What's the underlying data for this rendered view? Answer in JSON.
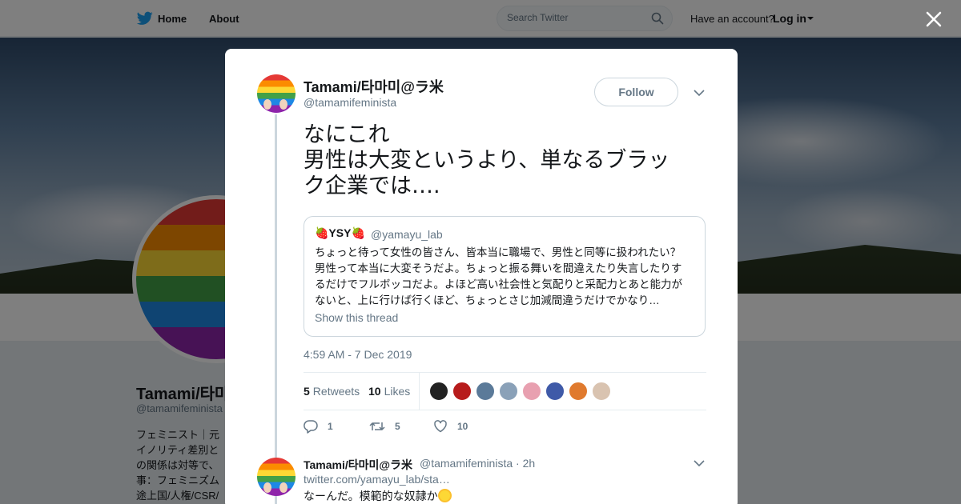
{
  "nav": {
    "home_label": "Home",
    "about_label": "About",
    "search_placeholder": "Search Twitter",
    "have_account": "Have an account?",
    "login_label": "Log in"
  },
  "profile": {
    "name": "Tamami/타마미@ラ米",
    "handle": "@tamamifeminista",
    "bio_lines": [
      "フェミニスト｜元",
      "イノリティ差別と",
      "の関係は対等で、",
      "事：フェミニズム",
      "途上国/人権/CSR/"
    ]
  },
  "tweet": {
    "author_name": "Tamami/타마미@ラ米",
    "author_handle": "@tamamifeminista",
    "follow_label": "Follow",
    "text_lines": [
      "なにこれ",
      "男性は大変というより、単なるブラッ",
      "ク企業では…."
    ],
    "quote": {
      "name": "🍓YSY🍓",
      "handle": "@yamayu_lab",
      "text_lines": [
        "ちょっと待って女性の皆さん、皆本当に職場で、男性と同等に扱われたい？",
        "男性って本当に大変そうだよ。ちょっと振る舞いを間違えたり失言したりす",
        "るだけでフルボッコだよ。よほど高い社会性と気配りと采配力とあと能力が",
        "ないと、上に行けば行くほど、ちょっとさじ加減間違うだけでかなり…"
      ],
      "show_thread": "Show this thread"
    },
    "timestamp": "4:59 AM - 7 Dec 2019",
    "retweets_count": "5",
    "retweets_label": "Retweets",
    "likes_count": "10",
    "likes_label": "Likes",
    "liker_colors": [
      "#222222",
      "#b71c1c",
      "#5b7a99",
      "#8aa1b8",
      "#e8a0b0",
      "#3f5aa8",
      "#e07a2e",
      "#d9c3b0"
    ],
    "actions": {
      "reply_count": "1",
      "retweet_count": "5",
      "like_count": "10"
    }
  },
  "reply": {
    "author_name": "Tamami/타마미@ラ米",
    "author_handle": "@tamamifeminista",
    "time": "2h",
    "link": "twitter.com/yamayu_lab/sta…",
    "text": "なーんだ。模範的な奴隷か"
  },
  "colors": {
    "brand": "#1da1f2",
    "text": "#14171a",
    "muted": "#657786"
  }
}
